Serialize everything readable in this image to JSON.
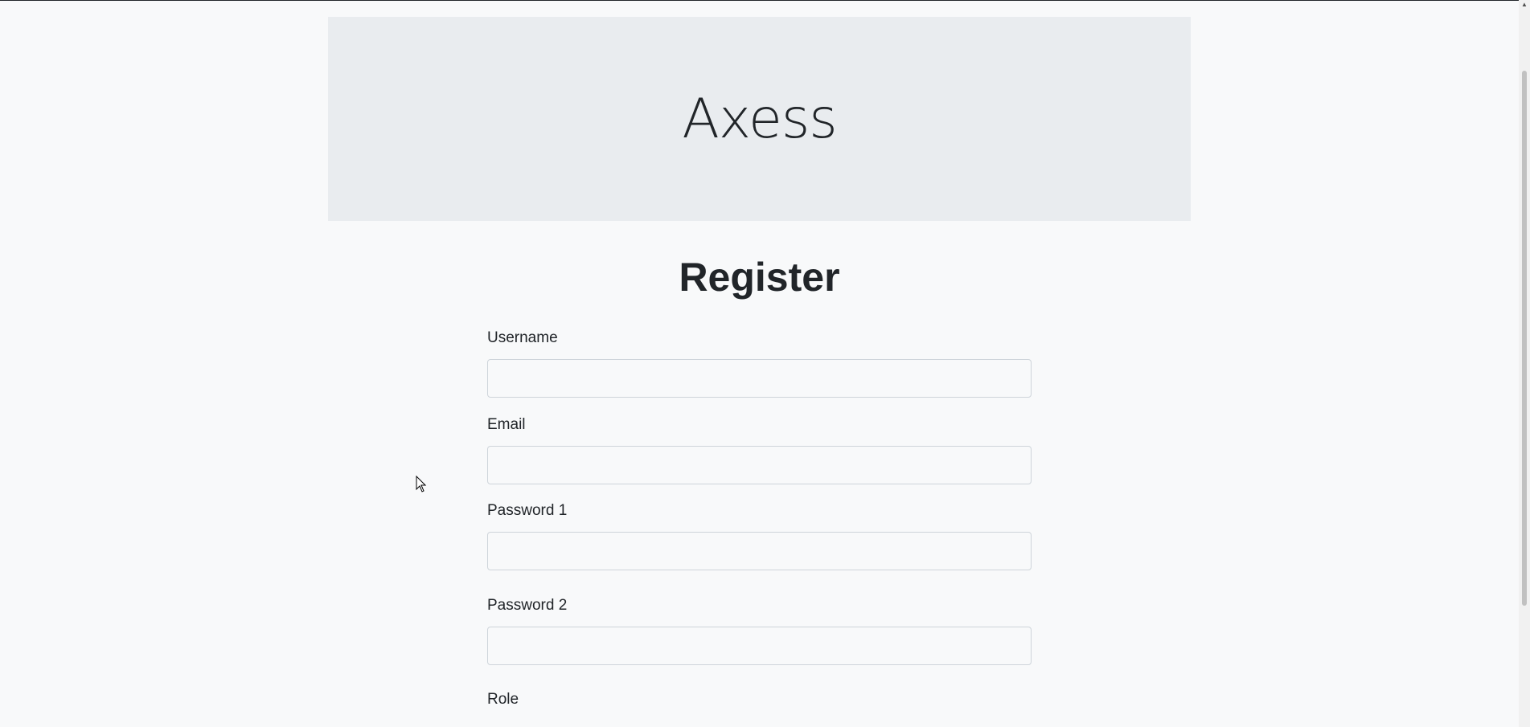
{
  "app": {
    "brand": "Axess"
  },
  "page": {
    "title": "Register"
  },
  "form": {
    "username": {
      "label": "Username",
      "value": "",
      "placeholder": ""
    },
    "email": {
      "label": "Email",
      "value": "",
      "placeholder": ""
    },
    "password1": {
      "label": "Password 1",
      "value": "",
      "placeholder": ""
    },
    "password2": {
      "label": "Password 2",
      "value": "",
      "placeholder": ""
    },
    "role": {
      "label": "Role"
    }
  },
  "colors": {
    "background": "#f8f9fa",
    "jumbotron": "#e9ecef",
    "text": "#212529",
    "input_border": "#ced4da"
  }
}
